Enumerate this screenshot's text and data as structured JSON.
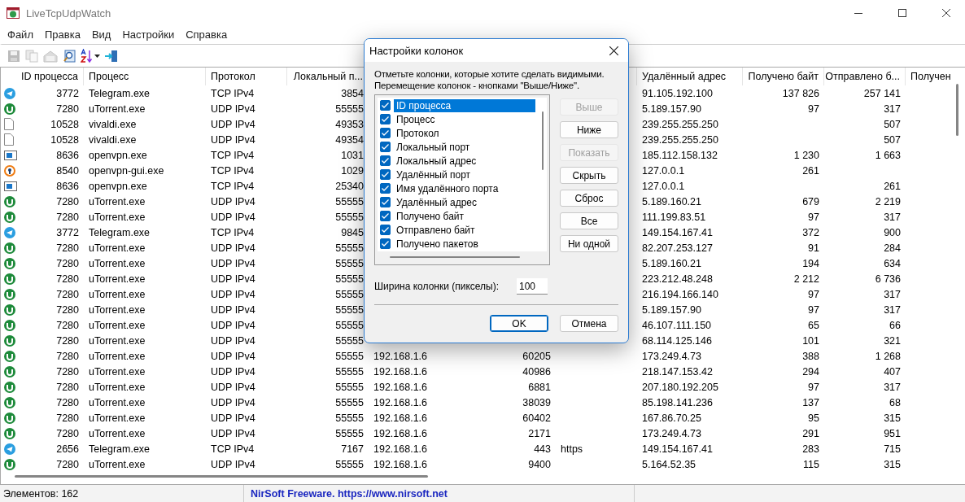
{
  "window": {
    "title": "LiveTcpUdpWatch"
  },
  "menu": [
    "Файл",
    "Правка",
    "Вид",
    "Настройки",
    "Справка"
  ],
  "toolbar": [
    {
      "kind": "save",
      "disabled": true
    },
    {
      "kind": "copy",
      "disabled": true
    },
    {
      "kind": "properties",
      "disabled": true
    },
    {
      "kind": "find",
      "disabled": false
    },
    {
      "kind": "sort",
      "disabled": false
    },
    {
      "kind": "exit",
      "disabled": false
    }
  ],
  "table": {
    "columns": [
      "ID процесса",
      "Процесс",
      "Протокол",
      "Локальный п...",
      null,
      null,
      null,
      "Удалённый адрес",
      "Получено байт",
      "Отправлено б...",
      "Получен"
    ],
    "rows": [
      {
        "kind": "plane",
        "cells": [
          "3772",
          "Telegram.exe",
          "TCP IPv4",
          "3854",
          null,
          null,
          null,
          "91.105.192.100",
          "137 826",
          "257 141",
          null
        ]
      },
      {
        "kind": "torrent",
        "cells": [
          "7280",
          "uTorrent.exe",
          "UDP IPv4",
          "55555",
          null,
          null,
          null,
          "5.189.157.90",
          "97",
          "317",
          null
        ]
      },
      {
        "kind": "document",
        "cells": [
          "10528",
          "vivaldi.exe",
          "UDP IPv4",
          "49353",
          null,
          null,
          null,
          "239.255.255.250",
          null,
          "507",
          null
        ]
      },
      {
        "kind": "document",
        "cells": [
          "10528",
          "vivaldi.exe",
          "UDP IPv4",
          "49354",
          null,
          null,
          null,
          "239.255.255.250",
          null,
          "507",
          null
        ]
      },
      {
        "kind": "window",
        "cells": [
          "8636",
          "openvpn.exe",
          "TCP IPv4",
          "1031",
          null,
          null,
          null,
          "185.112.158.132",
          "1 230",
          "1 663",
          null
        ]
      },
      {
        "kind": "keyhole",
        "cells": [
          "8540",
          "openvpn-gui.exe",
          "TCP IPv4",
          "1029",
          null,
          null,
          null,
          "127.0.0.1",
          "261",
          null,
          null
        ]
      },
      {
        "kind": "window",
        "cells": [
          "8636",
          "openvpn.exe",
          "TCP IPv4",
          "25340",
          null,
          null,
          null,
          "127.0.0.1",
          null,
          "261",
          null
        ]
      },
      {
        "kind": "torrent",
        "cells": [
          "7280",
          "uTorrent.exe",
          "UDP IPv4",
          "55555",
          null,
          null,
          null,
          "5.189.160.21",
          "679",
          "2 219",
          null
        ]
      },
      {
        "kind": "torrent",
        "cells": [
          "7280",
          "uTorrent.exe",
          "UDP IPv4",
          "55555",
          null,
          null,
          null,
          "111.199.83.51",
          "97",
          "317",
          null
        ]
      },
      {
        "kind": "plane",
        "cells": [
          "3772",
          "Telegram.exe",
          "TCP IPv4",
          "9845",
          null,
          null,
          null,
          "149.154.167.41",
          "372",
          "900",
          null
        ]
      },
      {
        "kind": "torrent",
        "cells": [
          "7280",
          "uTorrent.exe",
          "UDP IPv4",
          "55555",
          null,
          null,
          null,
          "82.207.253.127",
          "91",
          "284",
          null
        ]
      },
      {
        "kind": "torrent",
        "cells": [
          "7280",
          "uTorrent.exe",
          "UDP IPv4",
          "55555",
          null,
          null,
          null,
          "5.189.160.21",
          "194",
          "634",
          null
        ]
      },
      {
        "kind": "torrent",
        "cells": [
          "7280",
          "uTorrent.exe",
          "UDP IPv4",
          "55555",
          null,
          null,
          null,
          "223.212.48.248",
          "2 212",
          "6 736",
          null
        ]
      },
      {
        "kind": "torrent",
        "cells": [
          "7280",
          "uTorrent.exe",
          "UDP IPv4",
          "55555",
          null,
          null,
          null,
          "216.194.166.140",
          "97",
          "317",
          null
        ]
      },
      {
        "kind": "torrent",
        "cells": [
          "7280",
          "uTorrent.exe",
          "UDP IPv4",
          "55555",
          null,
          null,
          null,
          "5.189.157.90",
          "97",
          "317",
          null
        ]
      },
      {
        "kind": "torrent",
        "cells": [
          "7280",
          "uTorrent.exe",
          "UDP IPv4",
          "55555",
          null,
          null,
          null,
          "46.107.111.150",
          "65",
          "66",
          null
        ]
      },
      {
        "kind": "torrent",
        "cells": [
          "7280",
          "uTorrent.exe",
          "UDP IPv4",
          "55555",
          null,
          null,
          null,
          "68.114.125.146",
          "101",
          "321",
          null
        ]
      },
      {
        "kind": "torrent",
        "cells": [
          "7280",
          "uTorrent.exe",
          "UDP IPv4",
          "55555",
          "192.168.1.6",
          "60205",
          null,
          "173.249.4.73",
          "388",
          "1 268",
          null
        ]
      },
      {
        "kind": "torrent",
        "cells": [
          "7280",
          "uTorrent.exe",
          "UDP IPv4",
          "55555",
          "192.168.1.6",
          "40986",
          null,
          "218.147.153.42",
          "294",
          "407",
          null
        ]
      },
      {
        "kind": "torrent",
        "cells": [
          "7280",
          "uTorrent.exe",
          "UDP IPv4",
          "55555",
          "192.168.1.6",
          "6881",
          null,
          "207.180.192.205",
          "97",
          "317",
          null
        ]
      },
      {
        "kind": "torrent",
        "cells": [
          "7280",
          "uTorrent.exe",
          "UDP IPv4",
          "55555",
          "192.168.1.6",
          "38039",
          null,
          "85.198.141.236",
          "137",
          "68",
          null
        ]
      },
      {
        "kind": "torrent",
        "cells": [
          "7280",
          "uTorrent.exe",
          "UDP IPv4",
          "55555",
          "192.168.1.6",
          "60402",
          null,
          "167.86.70.25",
          "95",
          "315",
          null
        ]
      },
      {
        "kind": "torrent",
        "cells": [
          "7280",
          "uTorrent.exe",
          "UDP IPv4",
          "55555",
          "192.168.1.6",
          "2171",
          null,
          "173.249.4.73",
          "291",
          "951",
          null
        ]
      },
      {
        "kind": "plane",
        "cells": [
          "2656",
          "Telegram.exe",
          "TCP IPv4",
          "7167",
          "192.168.1.6",
          "443",
          "https",
          "149.154.167.41",
          "283",
          "715",
          null
        ]
      },
      {
        "kind": "torrent",
        "cells": [
          "7280",
          "uTorrent.exe",
          "UDP IPv4",
          "55555",
          "192.168.1.6",
          "9400",
          null,
          "5.164.52.35",
          "115",
          "315",
          null
        ]
      }
    ]
  },
  "status_bar": {
    "count": "Элементов: 162",
    "credit": "NirSoft Freeware. https://www.nirsoft.net"
  },
  "dialog": {
    "title": "Настройки колонок",
    "description": [
      "Отметьте колонки, которые хотите сделать видимыми.",
      "Перемещение колонок - кнопками \"Выше/Ниже\"."
    ],
    "columns": [
      {
        "label": "ID процесса",
        "checked": true,
        "selected": true
      },
      {
        "label": "Процесс",
        "checked": true,
        "selected": false
      },
      {
        "label": "Протокол",
        "checked": true,
        "selected": false
      },
      {
        "label": "Локальный порт",
        "checked": true,
        "selected": false
      },
      {
        "label": "Локальный адрес",
        "checked": true,
        "selected": false
      },
      {
        "label": "Удалённый порт",
        "checked": true,
        "selected": false
      },
      {
        "label": "Имя удалённого порта",
        "checked": true,
        "selected": false
      },
      {
        "label": "Удалённый адрес",
        "checked": true,
        "selected": false
      },
      {
        "label": "Получено байт",
        "checked": true,
        "selected": false
      },
      {
        "label": "Отправлено байт",
        "checked": true,
        "selected": false
      },
      {
        "label": "Получено пакетов",
        "checked": true,
        "selected": false
      }
    ],
    "side_buttons": [
      {
        "label": "Выше",
        "disabled": true
      },
      {
        "label": "Ниже",
        "disabled": false
      },
      {
        "label": "Показать",
        "disabled": true
      },
      {
        "label": "Скрыть",
        "disabled": false
      },
      {
        "label": "Сброс",
        "disabled": false
      },
      {
        "label": "Все",
        "disabled": false
      },
      {
        "label": "Ни одной",
        "disabled": false
      }
    ],
    "width_label": "Ширина колонки (пикселы):",
    "width_value": "100",
    "buttons": [
      {
        "label": "OK",
        "default": true
      },
      {
        "label": "Отмена",
        "default": false
      }
    ]
  }
}
